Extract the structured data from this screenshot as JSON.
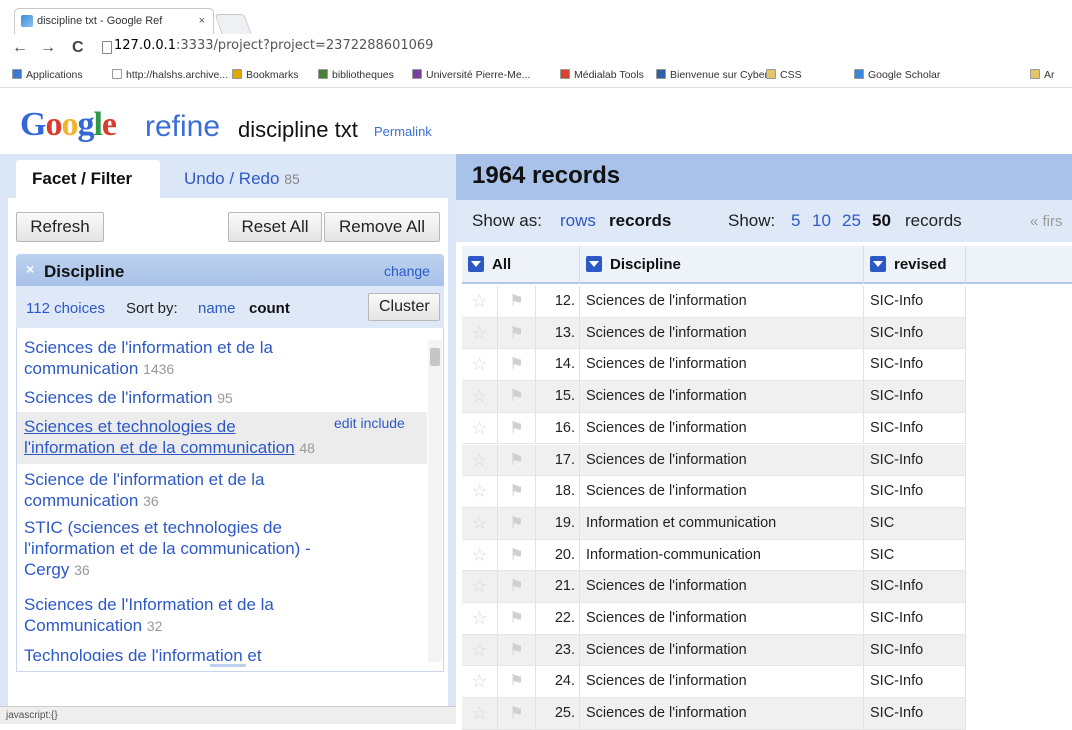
{
  "browser": {
    "tab_title": "discipline txt - Google Ref",
    "tab_close": "×",
    "url_host": "127.0.0.1",
    "url_rest": ":3333/project?project=2372288601069",
    "back": "←",
    "forward": "→",
    "reload": "C",
    "bookmarks": [
      {
        "label": "Applications",
        "color": "#3a7bd5"
      },
      {
        "label": "http://halshs.archive...",
        "color": "#ffffff"
      },
      {
        "label": "Bookmarks",
        "color": "#e0a800"
      },
      {
        "label": "bibliotheques",
        "color": "#4a7f3a"
      },
      {
        "label": "Université Pierre-Me...",
        "color": "#7a3fa0"
      },
      {
        "label": "Médialab Tools",
        "color": "#d9432e"
      },
      {
        "label": "Bienvenue sur Cyber...",
        "color": "#2e5fa8"
      },
      {
        "label": "CSS",
        "color": "#e5c56a"
      },
      {
        "label": "Google Scholar",
        "color": "#3a86d9"
      },
      {
        "label": "Ar",
        "color": "#e5c56a"
      }
    ],
    "status_text": "javascript:{}"
  },
  "header": {
    "logo_letters": [
      "G",
      "o",
      "o",
      "g",
      "l",
      "e"
    ],
    "refine_word": "refine",
    "project_title": "discipline txt",
    "permalink": "Permalink"
  },
  "left": {
    "tab_facet": "Facet / Filter",
    "tab_undo": "Undo / Redo",
    "undo_count": "85",
    "refresh": "Refresh",
    "reset_all": "Reset All",
    "remove_all": "Remove All",
    "facet": {
      "close": "×",
      "title": "Discipline",
      "change": "change",
      "choices_count": "112 choices",
      "sort_by": "Sort by:",
      "sort_name": "name",
      "sort_count": "count",
      "cluster": "Cluster",
      "edit": "edit",
      "include": "include",
      "items": [
        {
          "l1": "Sciences de l'information et de la",
          "l2": "communication",
          "n": "1436"
        },
        {
          "l1": "Sciences de l'information",
          "l2": "",
          "n": "95"
        },
        {
          "l1": "Sciences et technologies de",
          "l2": "l'information et de la communication",
          "n": "48"
        },
        {
          "l1": "Science de l'information et de la",
          "l2": "communication",
          "n": "36"
        },
        {
          "l1": "STIC (sciences et technologies de",
          "l2": "l'information et de la communication) -",
          "l3": "Cergy",
          "n": "36"
        },
        {
          "l1": "Sciences de l'Information et de la",
          "l2": "Communication",
          "n": "32"
        },
        {
          "l1": "Technologies de l'information et",
          "l2": "",
          "n": ""
        }
      ]
    }
  },
  "right": {
    "record_count": "1964 records",
    "show_as": "Show as:",
    "rows": "rows",
    "records": "records",
    "show": "Show:",
    "page_sizes": [
      "5",
      "10",
      "25",
      "50"
    ],
    "page_records": "records",
    "first": "« firs",
    "columns": [
      "All",
      "Discipline",
      "revised"
    ],
    "table_rows": [
      {
        "idx": "12.",
        "disc": "Sciences de l'information",
        "rev": "SIC-Info"
      },
      {
        "idx": "13.",
        "disc": "Sciences de l'information",
        "rev": "SIC-Info"
      },
      {
        "idx": "14.",
        "disc": "Sciences de l'information",
        "rev": "SIC-Info"
      },
      {
        "idx": "15.",
        "disc": "Sciences de l'information",
        "rev": "SIC-Info"
      },
      {
        "idx": "16.",
        "disc": "Sciences de l'information",
        "rev": "SIC-Info"
      },
      {
        "idx": "17.",
        "disc": "Sciences de l'information",
        "rev": "SIC-Info"
      },
      {
        "idx": "18.",
        "disc": "Sciences de l'information",
        "rev": "SIC-Info"
      },
      {
        "idx": "19.",
        "disc": "Information et communication",
        "rev": "SIC"
      },
      {
        "idx": "20.",
        "disc": "Information-communication",
        "rev": "SIC"
      },
      {
        "idx": "21.",
        "disc": "Sciences de l'information",
        "rev": "SIC-Info"
      },
      {
        "idx": "22.",
        "disc": "Sciences de l'information",
        "rev": "SIC-Info"
      },
      {
        "idx": "23.",
        "disc": "Sciences de l'information",
        "rev": "SIC-Info"
      },
      {
        "idx": "24.",
        "disc": "Sciences de l'information",
        "rev": "SIC-Info"
      },
      {
        "idx": "25.",
        "disc": "Sciences de l'information",
        "rev": "SIC-Info"
      }
    ],
    "star_icon": "☆",
    "flag_icon": "⚑"
  }
}
